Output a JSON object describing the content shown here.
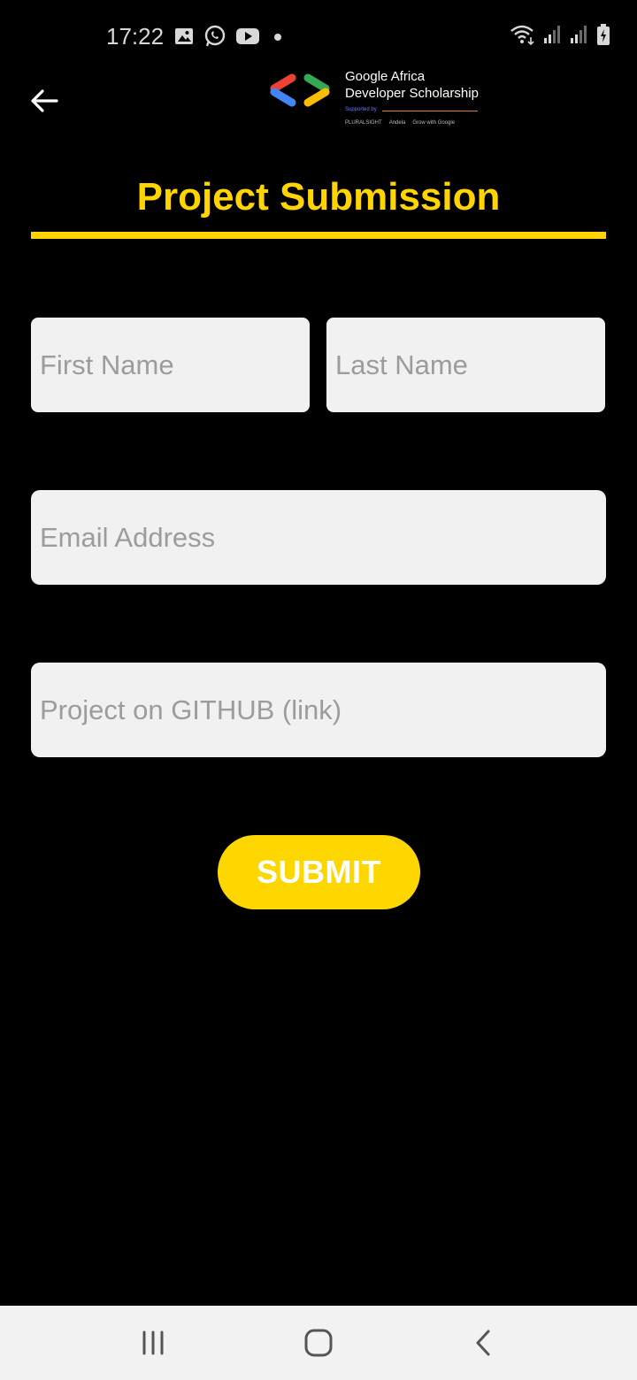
{
  "status_bar": {
    "time": "17:22",
    "left_icons": [
      "gallery-icon",
      "whatsapp-icon",
      "youtube-icon",
      "dot-icon"
    ],
    "right_icons": [
      "wifi-icon",
      "signal-icon",
      "signal-icon",
      "battery-charging-icon"
    ]
  },
  "header": {
    "back_icon": "arrow-left-icon",
    "logo": {
      "line1": "Google Africa",
      "line2": "Developer Scholarship",
      "supported_by": "Supported by",
      "partners": [
        "PLURALSIGHT",
        "Andela",
        "Grow with Google"
      ]
    }
  },
  "page": {
    "title": "Project Submission"
  },
  "form": {
    "first_name": {
      "value": "",
      "placeholder": "First Name"
    },
    "last_name": {
      "value": "",
      "placeholder": "Last Name"
    },
    "email": {
      "value": "",
      "placeholder": "Email Address"
    },
    "github": {
      "value": "",
      "placeholder": "Project on GITHUB (link)"
    },
    "submit_label": "SUBMIT"
  },
  "nav_bar": {
    "items": [
      "recent-apps-icon",
      "home-icon",
      "back-icon"
    ]
  },
  "colors": {
    "accent": "#FFD400",
    "button": "#FFD700",
    "background": "#000000",
    "field_bg": "#F1F1F1",
    "placeholder": "#9C9C9C"
  }
}
